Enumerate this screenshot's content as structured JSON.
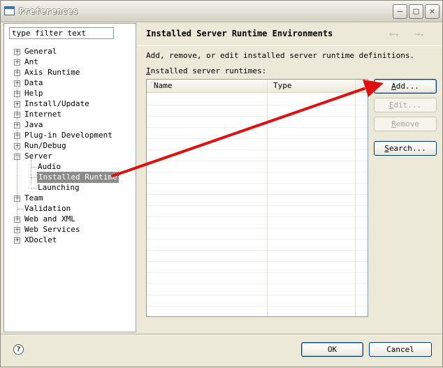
{
  "window": {
    "title": "Preferences"
  },
  "filter": {
    "value": "type filter text"
  },
  "tree": [
    {
      "label": "General",
      "expander": "+"
    },
    {
      "label": "Ant",
      "expander": "+"
    },
    {
      "label": "Axis Runtime",
      "expander": "+"
    },
    {
      "label": "Data",
      "expander": "+"
    },
    {
      "label": "Help",
      "expander": "+"
    },
    {
      "label": "Install/Update",
      "expander": "+"
    },
    {
      "label": "Internet",
      "expander": "+"
    },
    {
      "label": "Java",
      "expander": "+"
    },
    {
      "label": "Plug-in Development",
      "expander": "+"
    },
    {
      "label": "Run/Debug",
      "expander": "+"
    },
    {
      "label": "Server",
      "expander": "−"
    },
    {
      "label": "Audio",
      "expander": ""
    },
    {
      "label": "Installed Runtime",
      "expander": ""
    },
    {
      "label": "Launching",
      "expander": ""
    },
    {
      "label": "Team",
      "expander": "+"
    },
    {
      "label": "Validation",
      "expander": ""
    },
    {
      "label": "Web and XML",
      "expander": "+"
    },
    {
      "label": "Web Services",
      "expander": "+"
    },
    {
      "label": "XDoclet",
      "expander": "+"
    }
  ],
  "page": {
    "title": "Installed Server Runtime Environments",
    "description": "Add, remove, or edit installed server runtime definitions.",
    "table_label_mnemonic": "I",
    "table_label_rest": "nstalled server runtimes:",
    "columns": [
      "Name",
      "Type"
    ]
  },
  "buttons": {
    "add": {
      "mnemonic": "A",
      "rest": "dd..."
    },
    "edit": {
      "mnemonic": "E",
      "rest": "dit..."
    },
    "remove": {
      "mnemonic": "R",
      "rest": "emove"
    },
    "search": {
      "mnemonic": "S",
      "rest": "earch..."
    },
    "ok": "OK",
    "cancel": "Cancel"
  },
  "icons": {
    "back": "←",
    "forward": "→",
    "dropdown": "▾",
    "minimize": "–",
    "maximize": "□",
    "close": "✕",
    "help": "?"
  },
  "colors": {
    "annotation_arrow": "#e01010",
    "selection": "#8d8d87"
  }
}
